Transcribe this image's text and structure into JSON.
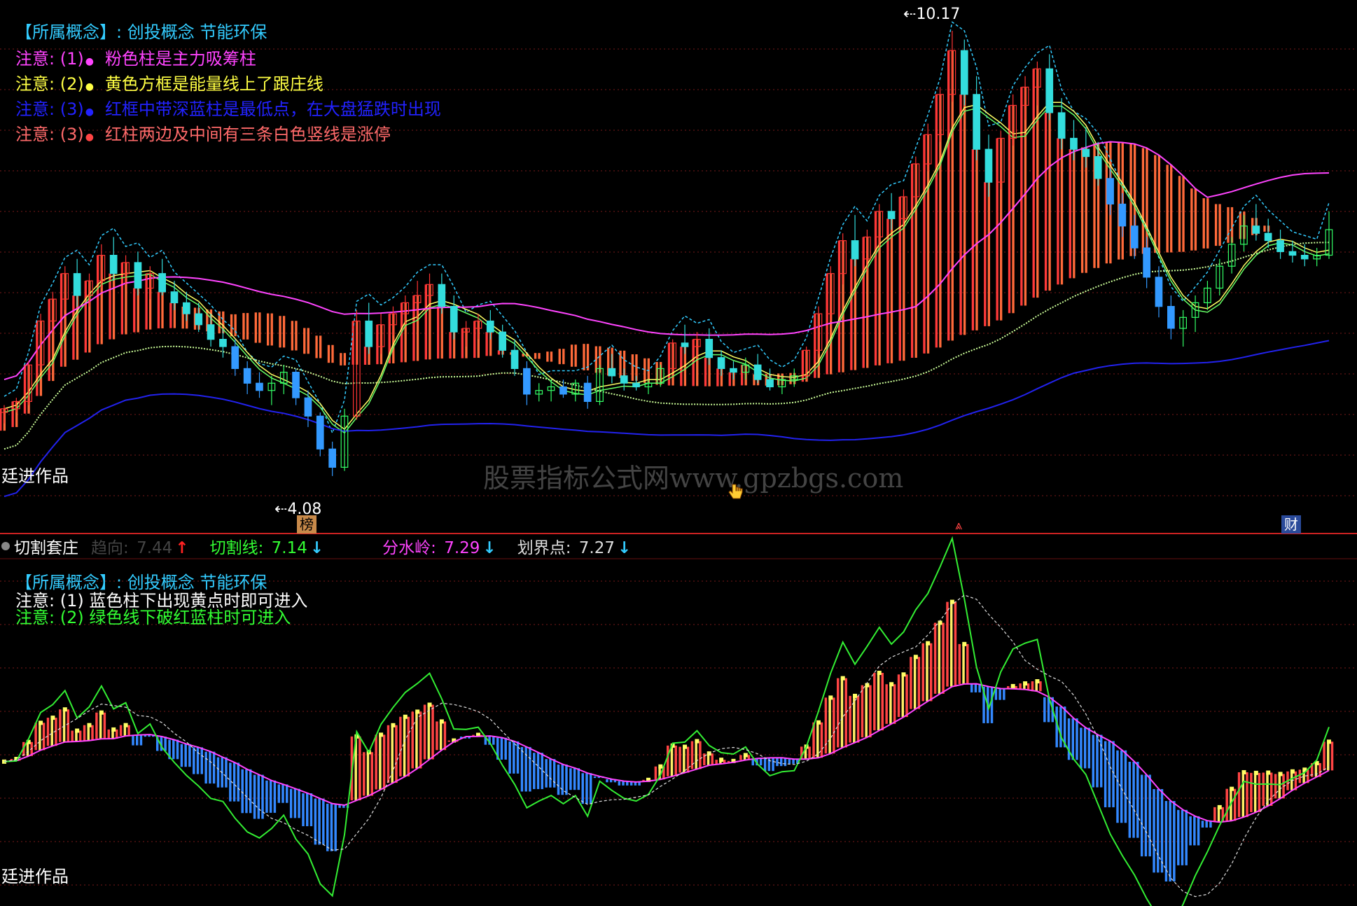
{
  "top_panel": {
    "concept_line": "【所属概念】: 创投概念 节能环保",
    "notes": [
      {
        "prefix": "注意: (1)",
        "dot": "●",
        "text": "粉色柱是主力吸筹柱",
        "color": "#ff44ff",
        "dot_color": "#ff44ff"
      },
      {
        "prefix": "注意: (2)",
        "dot": "●",
        "text": "黄色方框是能量线上了跟庄线",
        "color": "#ffff44",
        "dot_color": "#ffff44"
      },
      {
        "prefix": "注意: (3)",
        "dot": "●",
        "text": "红框中带深蓝柱是最低点，在大盘猛跌时出现",
        "color": "#2222ff",
        "dot_color": "#2222ff"
      },
      {
        "prefix": "注意: (3)",
        "dot": "●",
        "text": "红柱两边及中间有三条白色竖线是涨停",
        "color": "#ff6a6a",
        "dot_color": "#ff4444"
      }
    ],
    "author": "廷进作品",
    "high_label": "10.17",
    "low_label": "4.08",
    "badge_bang": "榜",
    "badge_cai": "财",
    "watermark": "股票指标公式网www.gpzbgs.com"
  },
  "indicator_bar": {
    "name": "切割套庄",
    "items": [
      {
        "label": "趋向:",
        "value": "7.44",
        "arrow": "↑",
        "color": "#444444",
        "arrow_color": "#ff2222"
      },
      {
        "label": "切割线:",
        "value": "7.14",
        "arrow": "↓",
        "color": "#33ff33",
        "arrow_color": "#33ccff"
      },
      {
        "label": "分水岭:",
        "value": "7.29",
        "arrow": "↓",
        "color": "#ff44ff",
        "arrow_color": "#33ccff"
      },
      {
        "label": "划界点:",
        "value": "7.27",
        "arrow": "↓",
        "color": "#dddddd",
        "arrow_color": "#33ccff"
      }
    ]
  },
  "bottom_panel": {
    "concept_line": "【所属概念】: 创投概念 节能环保",
    "notes": [
      {
        "text": "注意: (1) 蓝色柱下出现黄点时即可进入",
        "color": "#ffffff"
      },
      {
        "text": "注意: (2) 绿色线下破红蓝柱时可进入",
        "color": "#33ff33"
      }
    ],
    "author": "廷进作品"
  },
  "chart_data": [
    {
      "type": "candlestick",
      "title": "",
      "price_high": 10.17,
      "price_low": 4.08,
      "overlay_lines": [
        "pink-line",
        "light-green-line",
        "blue-line",
        "white-dotted-line",
        "cyan-dashed-band"
      ],
      "candles": [
        [
          4.95,
          5.05,
          4.8,
          5.0
        ],
        [
          5.0,
          5.15,
          4.95,
          5.1
        ],
        [
          5.1,
          5.65,
          5.05,
          5.6
        ],
        [
          5.6,
          6.3,
          5.55,
          6.2
        ],
        [
          6.2,
          6.6,
          6.05,
          6.5
        ],
        [
          6.5,
          6.95,
          6.35,
          6.85
        ],
        [
          6.85,
          7.05,
          6.4,
          6.55
        ],
        [
          6.55,
          6.85,
          6.4,
          6.75
        ],
        [
          6.75,
          7.25,
          6.65,
          7.1
        ],
        [
          7.1,
          7.35,
          6.75,
          6.85
        ],
        [
          6.85,
          7.1,
          6.7,
          7.0
        ],
        [
          7.0,
          7.15,
          6.55,
          6.65
        ],
        [
          6.65,
          6.95,
          6.5,
          6.85
        ],
        [
          6.85,
          7.05,
          6.55,
          6.6
        ],
        [
          6.6,
          6.75,
          6.35,
          6.45
        ],
        [
          6.45,
          6.6,
          6.2,
          6.3
        ],
        [
          6.3,
          6.45,
          6.05,
          6.15
        ],
        [
          6.15,
          6.3,
          5.85,
          5.95
        ],
        [
          5.95,
          6.1,
          5.7,
          5.85
        ],
        [
          5.85,
          5.95,
          5.45,
          5.55
        ],
        [
          5.55,
          5.65,
          5.2,
          5.35
        ],
        [
          5.35,
          5.5,
          5.15,
          5.25
        ],
        [
          5.25,
          5.45,
          5.05,
          5.35
        ],
        [
          5.35,
          5.6,
          5.2,
          5.5
        ],
        [
          5.5,
          5.55,
          5.05,
          5.15
        ],
        [
          5.15,
          5.25,
          4.75,
          4.9
        ],
        [
          4.9,
          4.95,
          4.35,
          4.45
        ],
        [
          4.45,
          4.55,
          4.08,
          4.2
        ],
        [
          4.2,
          5.0,
          4.15,
          4.9
        ],
        [
          4.9,
          6.35,
          4.85,
          6.2
        ],
        [
          6.2,
          6.45,
          5.75,
          5.85
        ],
        [
          5.85,
          6.3,
          5.75,
          6.15
        ],
        [
          6.15,
          6.4,
          6.0,
          6.3
        ],
        [
          6.3,
          6.55,
          6.15,
          6.45
        ],
        [
          6.45,
          6.75,
          6.25,
          6.55
        ],
        [
          6.55,
          6.85,
          6.45,
          6.7
        ],
        [
          6.7,
          6.85,
          6.3,
          6.4
        ],
        [
          6.4,
          6.55,
          5.95,
          6.05
        ],
        [
          6.05,
          6.2,
          5.85,
          6.1
        ],
        [
          6.1,
          6.3,
          5.95,
          6.2
        ],
        [
          6.2,
          6.35,
          5.95,
          6.05
        ],
        [
          6.05,
          6.15,
          5.7,
          5.8
        ],
        [
          5.8,
          5.95,
          5.45,
          5.55
        ],
        [
          5.55,
          5.65,
          5.05,
          5.2
        ],
        [
          5.2,
          5.35,
          5.1,
          5.25
        ],
        [
          5.25,
          5.4,
          5.1,
          5.3
        ],
        [
          5.3,
          5.4,
          5.15,
          5.2
        ],
        [
          5.2,
          5.4,
          5.1,
          5.35
        ],
        [
          5.35,
          5.45,
          5.0,
          5.1
        ],
        [
          5.1,
          5.6,
          5.05,
          5.55
        ],
        [
          5.55,
          5.75,
          5.35,
          5.45
        ],
        [
          5.45,
          5.55,
          5.25,
          5.35
        ],
        [
          5.35,
          5.45,
          5.25,
          5.3
        ],
        [
          5.3,
          5.4,
          5.2,
          5.35
        ],
        [
          5.35,
          5.6,
          5.3,
          5.55
        ],
        [
          5.55,
          5.95,
          5.5,
          5.9
        ],
        [
          5.9,
          6.15,
          5.75,
          5.85
        ],
        [
          5.85,
          6.05,
          5.7,
          5.95
        ],
        [
          5.95,
          6.1,
          5.6,
          5.7
        ],
        [
          5.7,
          5.8,
          5.45,
          5.55
        ],
        [
          5.55,
          5.65,
          5.4,
          5.5
        ],
        [
          5.5,
          5.7,
          5.4,
          5.6
        ],
        [
          5.6,
          5.75,
          5.35,
          5.4
        ],
        [
          5.4,
          5.55,
          5.25,
          5.3
        ],
        [
          5.3,
          5.45,
          5.2,
          5.4
        ],
        [
          5.4,
          5.55,
          5.3,
          5.45
        ],
        [
          5.45,
          5.85,
          5.4,
          5.8
        ],
        [
          5.8,
          6.4,
          5.75,
          6.3
        ],
        [
          6.3,
          6.95,
          6.2,
          6.85
        ],
        [
          6.85,
          7.4,
          6.7,
          7.3
        ],
        [
          7.3,
          7.65,
          6.95,
          7.05
        ],
        [
          7.05,
          7.45,
          6.9,
          7.35
        ],
        [
          7.35,
          7.8,
          7.2,
          7.7
        ],
        [
          7.7,
          7.95,
          7.45,
          7.6
        ],
        [
          7.6,
          8.0,
          7.5,
          7.9
        ],
        [
          7.9,
          8.45,
          7.8,
          8.35
        ],
        [
          8.35,
          8.9,
          8.25,
          8.75
        ],
        [
          8.75,
          9.4,
          8.65,
          9.3
        ],
        [
          9.3,
          10.17,
          9.2,
          9.9
        ],
        [
          9.9,
          10.05,
          9.15,
          9.3
        ],
        [
          9.3,
          9.55,
          8.4,
          8.55
        ],
        [
          8.55,
          8.75,
          7.9,
          8.1
        ],
        [
          8.1,
          8.8,
          8.0,
          8.7
        ],
        [
          8.7,
          9.3,
          8.6,
          9.15
        ],
        [
          9.15,
          9.55,
          8.95,
          9.4
        ],
        [
          9.4,
          9.75,
          9.15,
          9.65
        ],
        [
          9.65,
          9.85,
          8.95,
          9.05
        ],
        [
          9.05,
          9.25,
          8.55,
          8.7
        ],
        [
          8.7,
          8.95,
          8.4,
          8.55
        ],
        [
          8.55,
          8.85,
          8.3,
          8.45
        ],
        [
          8.45,
          8.65,
          8.05,
          8.15
        ],
        [
          8.15,
          8.3,
          7.65,
          7.8
        ],
        [
          7.8,
          7.95,
          7.35,
          7.5
        ],
        [
          7.5,
          7.65,
          7.05,
          7.2
        ],
        [
          7.2,
          7.35,
          6.65,
          6.8
        ],
        [
          6.8,
          6.95,
          6.25,
          6.4
        ],
        [
          6.4,
          6.55,
          5.95,
          6.1
        ],
        [
          6.1,
          6.35,
          5.85,
          6.25
        ],
        [
          6.25,
          6.55,
          6.05,
          6.45
        ],
        [
          6.45,
          6.75,
          6.35,
          6.65
        ],
        [
          6.65,
          7.05,
          6.55,
          6.95
        ],
        [
          6.95,
          7.35,
          6.85,
          7.25
        ],
        [
          7.25,
          7.65,
          7.15,
          7.5
        ],
        [
          7.5,
          7.8,
          7.3,
          7.4
        ],
        [
          7.4,
          7.6,
          7.2,
          7.3
        ],
        [
          7.3,
          7.45,
          7.05,
          7.15
        ],
        [
          7.15,
          7.3,
          7.0,
          7.1
        ],
        [
          7.1,
          7.25,
          6.95,
          7.05
        ],
        [
          7.05,
          7.2,
          6.95,
          7.1
        ],
        [
          7.1,
          7.7,
          7.05,
          7.45
        ]
      ]
    },
    {
      "type": "bar",
      "title": "",
      "series": [
        {
          "name": "切割线",
          "color": "#33ff33"
        },
        {
          "name": "分水岭",
          "color": "#ff44ff"
        },
        {
          "name": "划界点",
          "color": "#dddddd"
        }
      ]
    }
  ]
}
